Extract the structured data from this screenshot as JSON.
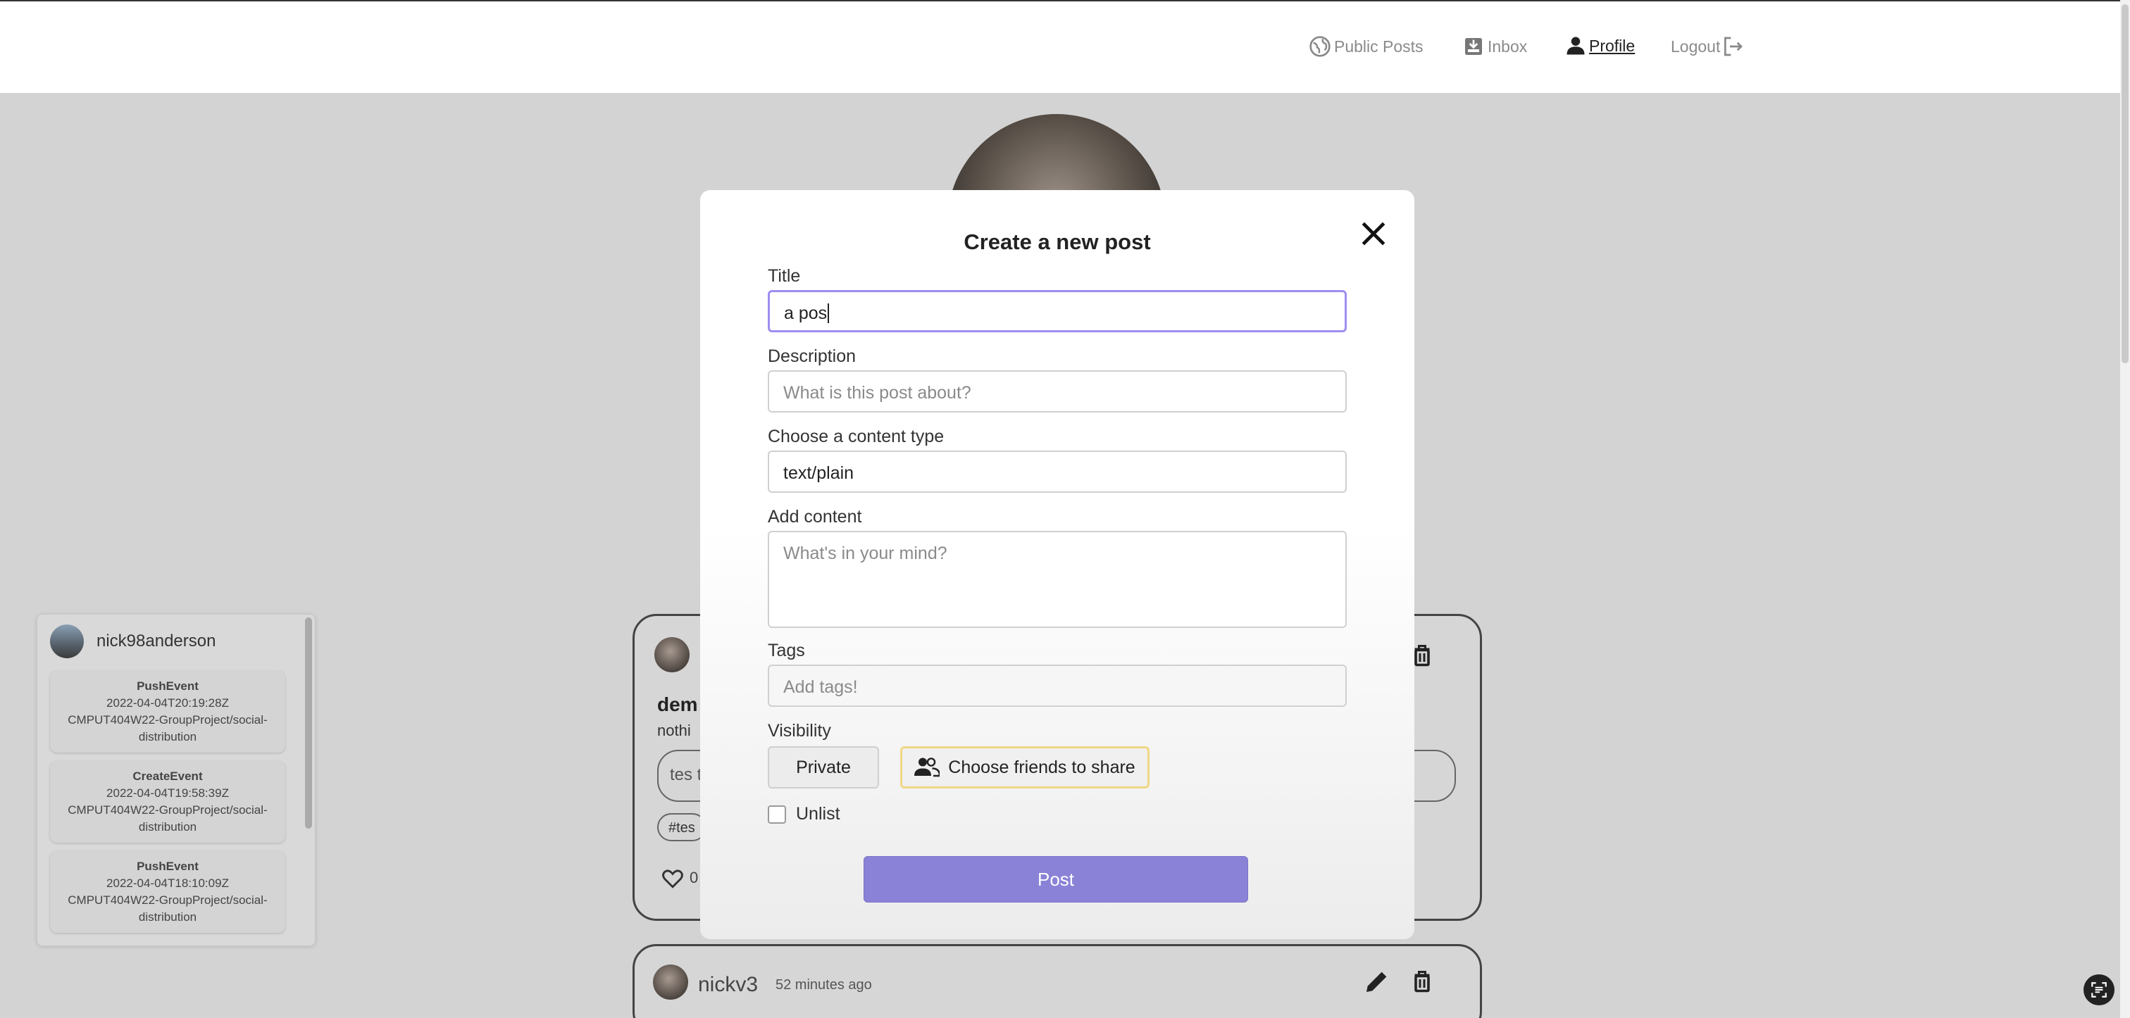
{
  "nav": {
    "public_posts": "Public Posts",
    "inbox": "Inbox",
    "profile": "Profile",
    "logout": "Logout"
  },
  "modal": {
    "title": "Create a new post",
    "title_label": "Title",
    "title_value": "a pos",
    "description_label": "Description",
    "description_placeholder": "What is this post about?",
    "content_type_label": "Choose a content type",
    "content_type_value": "text/plain",
    "content_label": "Add content",
    "content_placeholder": "What's in your mind?",
    "tags_label": "Tags",
    "tags_placeholder": "Add tags!",
    "visibility_label": "Visibility",
    "private_label": "Private",
    "share_label": "Choose friends to share",
    "unlist_label": "Unlist",
    "post_label": "Post"
  },
  "github": {
    "username": "nick98anderson",
    "events": [
      {
        "type": "PushEvent",
        "time": "2022-04-04T20:19:28Z",
        "repo": "CMPUT404W22-GroupProject/social-distribution"
      },
      {
        "type": "CreateEvent",
        "time": "2022-04-04T19:58:39Z",
        "repo": "CMPUT404W22-GroupProject/social-distribution"
      },
      {
        "type": "PushEvent",
        "time": "2022-04-04T18:10:09Z",
        "repo": "CMPUT404W22-GroupProject/social-distribution"
      }
    ]
  },
  "posts": [
    {
      "title": "dem",
      "description": "nothi",
      "comment_input": "tes t",
      "tag": "#tes",
      "likes": "0"
    },
    {
      "author": "nickv3",
      "time": "52 minutes ago"
    }
  ],
  "colors": {
    "accent": "#8a82d6",
    "focus_border": "#9d8ef0",
    "share_border": "#f0d784"
  }
}
